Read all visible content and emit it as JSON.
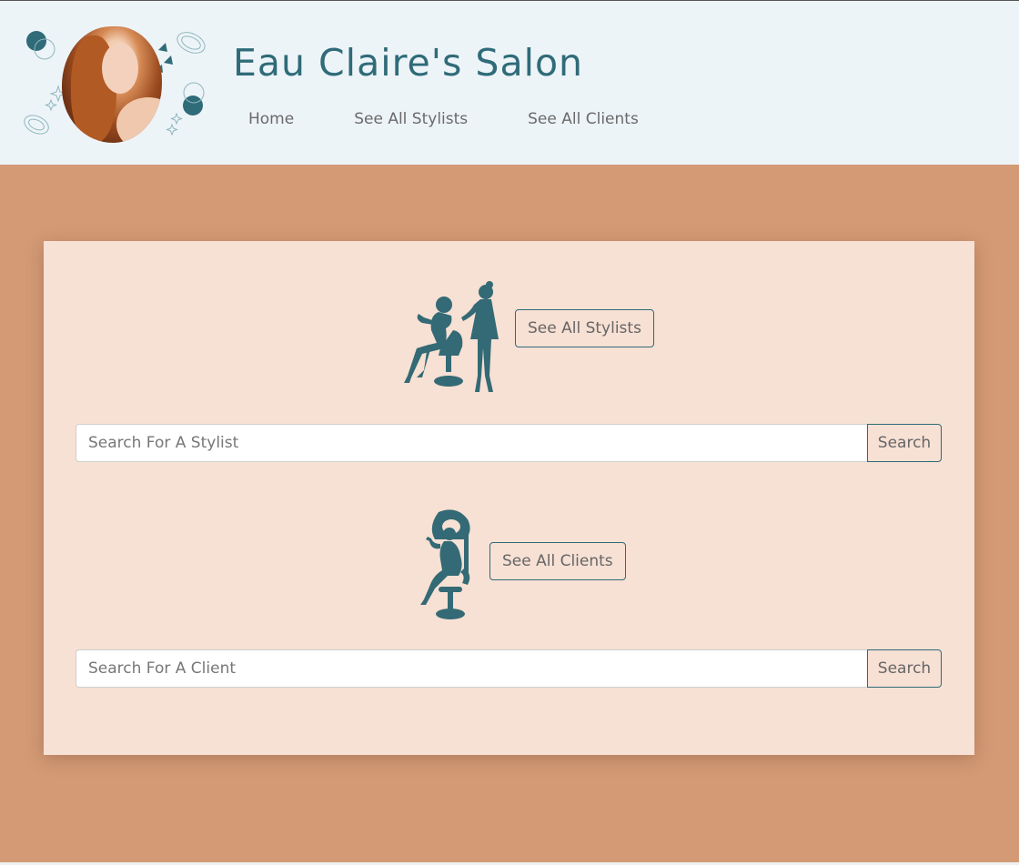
{
  "header": {
    "site_title": "Eau Claire's Salon",
    "nav": {
      "home": "Home",
      "stylists": "See All Stylists",
      "clients": "See All Clients"
    }
  },
  "stylists_section": {
    "illustration": "stylist-silhouette-icon",
    "button_label": "See All Stylists",
    "search_placeholder": "Search For A Stylist",
    "search_button": "Search"
  },
  "clients_section": {
    "illustration": "client-dryer-silhouette-icon",
    "button_label": "See All Clients",
    "search_placeholder": "Search For A Client",
    "search_button": "Search"
  },
  "colors": {
    "page_background": "#d39a75",
    "header_background": "#edf4f8",
    "card_background": "#f7e0d4",
    "accent_teal": "#2f6b78"
  }
}
